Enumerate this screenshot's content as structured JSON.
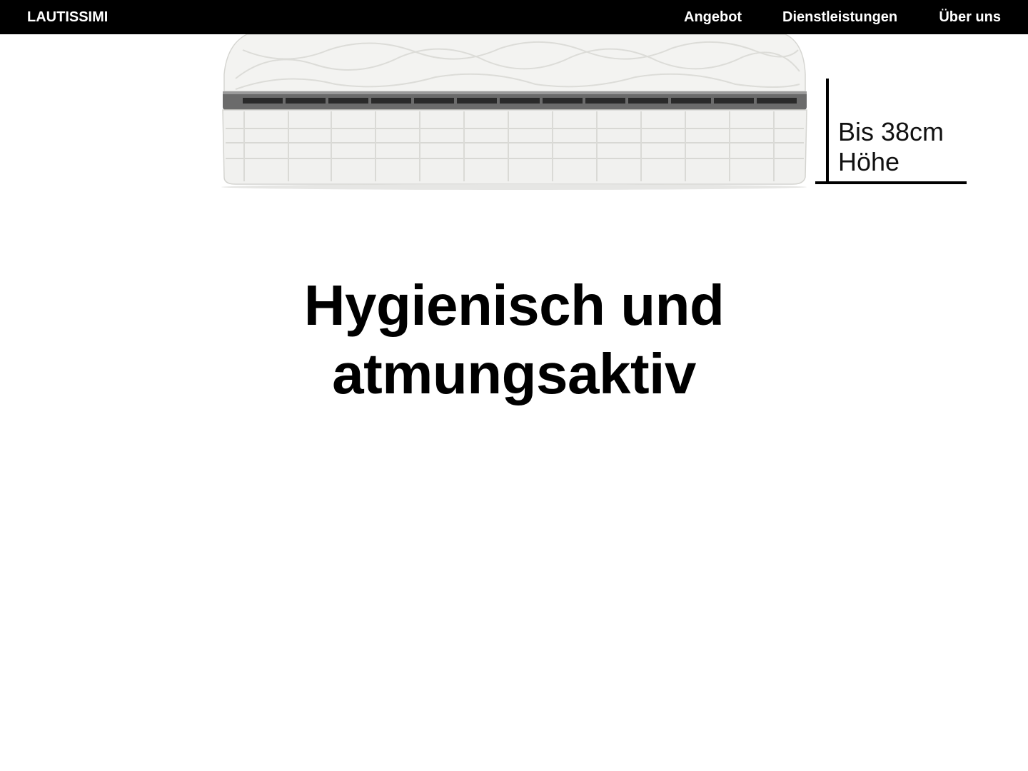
{
  "nav": {
    "brand": "LAUTISSIMI",
    "links": [
      "Angebot",
      "Dienstleistungen",
      "Über uns"
    ]
  },
  "hero": {
    "height_label_line1": "Bis 38cm",
    "height_label_line2": "Höhe"
  },
  "section": {
    "heading_line1": "Hygienisch und",
    "heading_line2": "atmungsaktiv"
  },
  "colors": {
    "nav_background": "#000000",
    "nav_text": "#ffffff",
    "page_background": "#ffffff",
    "mattress": "#f2f2f0",
    "mattress_band": "#6b6b6b"
  }
}
